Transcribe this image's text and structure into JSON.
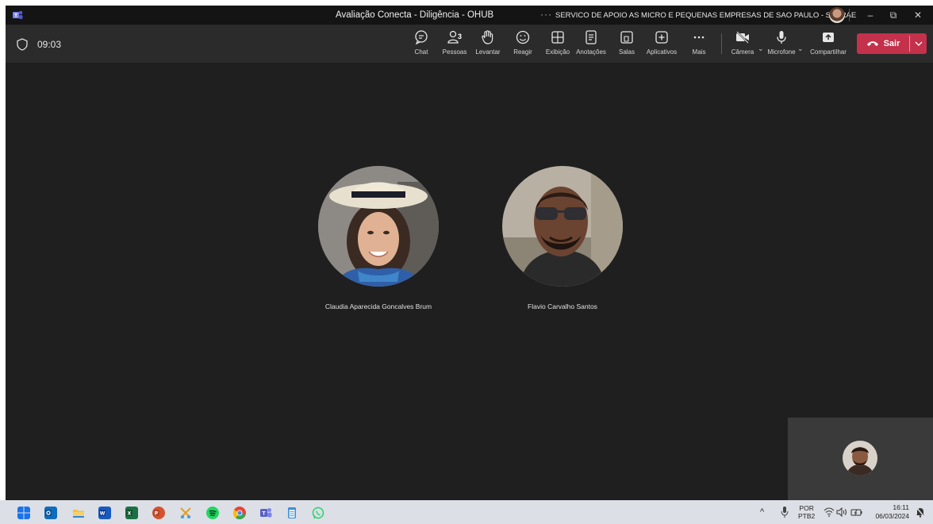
{
  "window": {
    "title": "Avaliação Conecta - Diligência - OHUB",
    "more": "···",
    "org": "SERVICO DE APOIO AS MICRO E PEQUENAS EMPRESAS DE SAO PAULO - SEBRAE",
    "minimize": "–",
    "restore": "⧉",
    "close": "✕"
  },
  "call": {
    "timer": "09:03",
    "toolbar": [
      {
        "id": "chat",
        "label": "Chat",
        "icon": "chat-icon"
      },
      {
        "id": "people",
        "label": "Pessoas",
        "icon": "people-icon",
        "badge": "3"
      },
      {
        "id": "raise",
        "label": "Levantar",
        "icon": "raise-hand-icon"
      },
      {
        "id": "react",
        "label": "Reagir",
        "icon": "react-icon"
      },
      {
        "id": "view",
        "label": "Exibição",
        "icon": "view-icon"
      },
      {
        "id": "notes",
        "label": "Anotações",
        "icon": "notes-icon"
      },
      {
        "id": "rooms",
        "label": "Salas",
        "icon": "rooms-icon"
      },
      {
        "id": "apps",
        "label": "Aplicativos",
        "icon": "apps-icon"
      },
      {
        "id": "more",
        "label": "Mais",
        "icon": "more-icon"
      },
      {
        "id": "camera",
        "label": "Câmera",
        "icon": "camera-off-icon"
      },
      {
        "id": "mic",
        "label": "Microfone",
        "icon": "microphone-icon"
      },
      {
        "id": "share",
        "label": "Compartilhar",
        "icon": "share-icon"
      }
    ],
    "leave_label": "Sair",
    "participants": [
      {
        "name": "Claudia Aparecida Goncalves Brum"
      },
      {
        "name": "Flavio Carvalho Santos"
      }
    ]
  },
  "taskbar": {
    "apps": [
      "start-icon",
      "outlook-icon",
      "file-explorer-icon",
      "word-icon",
      "excel-icon",
      "powerpoint-icon",
      "snipping-tool-icon",
      "spotify-icon",
      "chrome-icon",
      "teams-icon",
      "notepad-icon",
      "whatsapp-icon"
    ],
    "tray": {
      "chevron": "^",
      "lang_top": "POR",
      "lang_bottom": "PTB2",
      "time": "16:11",
      "date": "06/03/2024"
    }
  },
  "colors": {
    "stage": "#1f1f1f",
    "toolbar": "#2b2b2b",
    "leave": "#c4314b",
    "taskbar": "#dcdfe6"
  }
}
